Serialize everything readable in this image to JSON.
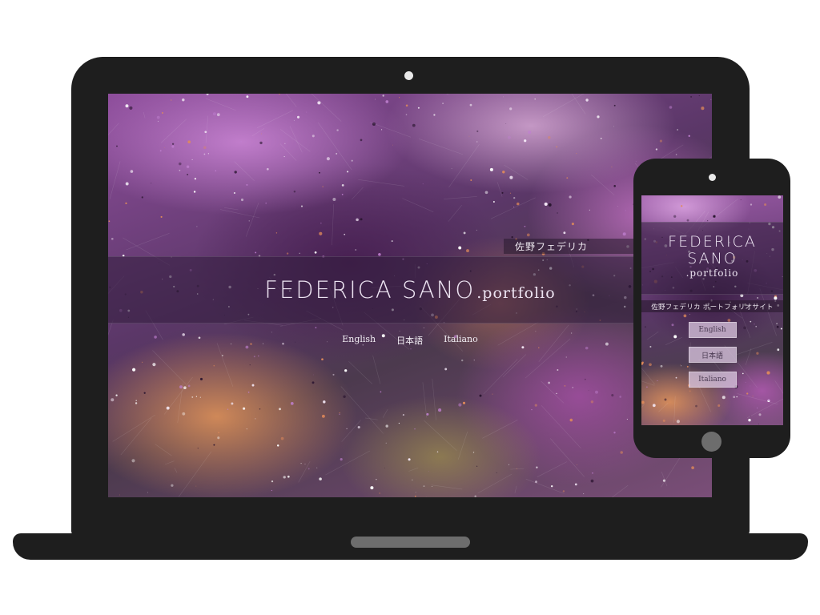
{
  "site": {
    "title_main": "FEDERICA SANO",
    "title_suffix": ".portfolio",
    "title_line1": "FEDERICA",
    "title_line2": "SANO",
    "subtitle_desktop": "佐野フェデリカ",
    "subtitle_mobile": "佐野フェデリカ ポートフォリオサイト"
  },
  "languages": [
    {
      "label": "English"
    },
    {
      "label": "日本語"
    },
    {
      "label": "Italiano"
    }
  ],
  "colors": {
    "device_frame": "#1e1e1e",
    "accent_purple": "#8e4e9c",
    "band": "#32203c",
    "button_bg": "#dcc8e1"
  }
}
